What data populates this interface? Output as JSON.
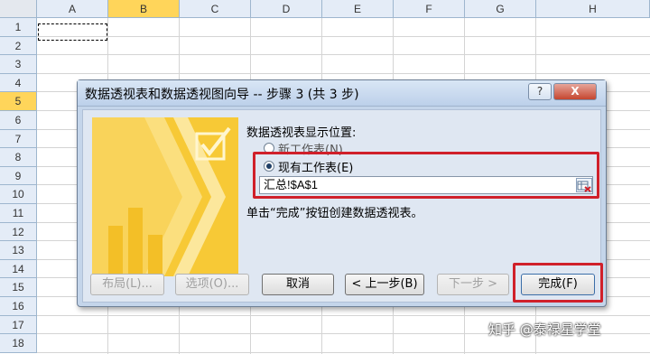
{
  "spreadsheet": {
    "columns": [
      "A",
      "B",
      "C",
      "D",
      "E",
      "F",
      "G",
      "H"
    ],
    "rows": [
      "1",
      "2",
      "3",
      "4",
      "5",
      "6",
      "7",
      "8",
      "9",
      "10",
      "11",
      "12",
      "13",
      "14",
      "15",
      "16",
      "17",
      "18"
    ],
    "selected_column": "B",
    "selected_row": "5"
  },
  "dialog": {
    "title": "数据透视表和数据透视图向导 -- 步骤 3 (共 3 步)",
    "help_label": "?",
    "close_label": "X",
    "location_prompt": "数据透视表显示位置:",
    "option_new_sheet": "新工作表(N)",
    "option_existing_sheet": "现有工作表(E)",
    "selected_option": "existing",
    "reference_value": "汇总!$A$1",
    "instruction": "单击“完成”按钮创建数据透视表。",
    "buttons": {
      "layout": "布局(L)...",
      "options": "选项(O)...",
      "cancel": "取消",
      "back": "< 上一步(B)",
      "next": "下一步 >",
      "finish": "完成(F)"
    }
  },
  "watermark": "知乎 @泰禄星学堂",
  "colors": {
    "highlight_box": "#d0202a",
    "header_selected": "#ffd55a",
    "art_yellow": "#f7c936"
  }
}
